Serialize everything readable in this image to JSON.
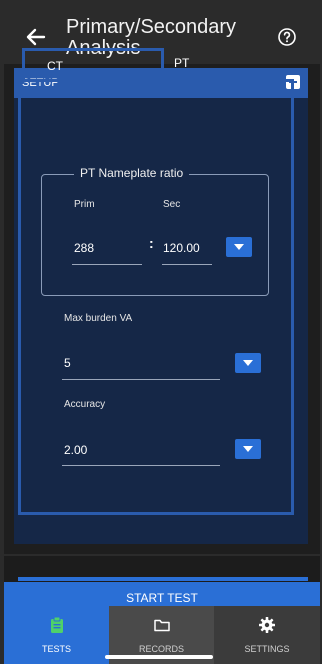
{
  "header": {
    "title_line1": "Primary/Secondary",
    "title_line2": "Analysis"
  },
  "setup": {
    "label": "SETUP"
  },
  "tabs": [
    {
      "label": "CT"
    },
    {
      "label": "PT"
    }
  ],
  "nameplate": {
    "title": "PT Nameplate ratio",
    "prim_label": "Prim",
    "sec_label": "Sec",
    "prim_value": "288",
    "separator": ":",
    "sec_value": "120.00"
  },
  "max_burden": {
    "label": "Max burden VA",
    "value": "5"
  },
  "accuracy": {
    "label": "Accuracy",
    "value": "2.00"
  },
  "start_test": {
    "label": "START TEST"
  },
  "bottom_nav": [
    {
      "label": "TESTS",
      "icon": "clipboard-icon"
    },
    {
      "label": "RECORDS",
      "icon": "folder-icon"
    },
    {
      "label": "SETTINGS",
      "icon": "gear-icon"
    }
  ],
  "colors": {
    "accent": "#2a5bad",
    "button": "#2a6fd6",
    "panel": "#152747"
  }
}
